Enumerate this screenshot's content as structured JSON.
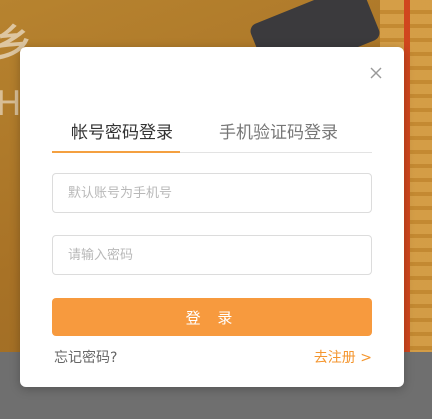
{
  "background": {
    "glyph": "乡",
    "letter": "H"
  },
  "modal": {
    "close_icon": "close-icon",
    "tabs": [
      {
        "label": "帐号密码登录",
        "active": true
      },
      {
        "label": "手机验证码登录",
        "active": false
      }
    ],
    "username": {
      "value": "",
      "placeholder": "默认账号为手机号"
    },
    "password": {
      "value": "",
      "placeholder": "请输入密码"
    },
    "login_button": "登 录",
    "forgot_link": "忘记密码?",
    "register_link": "去注册 >"
  },
  "colors": {
    "accent": "#f79a3e",
    "link_accent": "#f4962f",
    "tab_underline": "#f4a040"
  }
}
